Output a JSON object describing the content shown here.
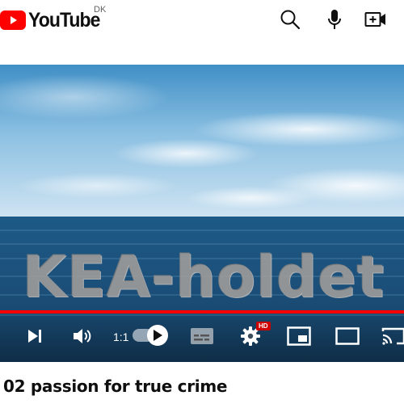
{
  "header": {
    "brand": "YouTube",
    "country_code": "DK",
    "icons": {
      "search": "search-icon",
      "voice": "microphone-icon",
      "create": "create-video-icon"
    }
  },
  "player": {
    "overlay_text": "KEA-holdet",
    "progress_fraction": 1.0,
    "speed_label": "1:1",
    "hd_badge": "HD",
    "controls": {
      "next": "skip-next-icon",
      "volume": "volume-icon",
      "autoplay": "autoplay-toggle",
      "captions": "captions-icon",
      "settings": "settings-gear-icon",
      "miniplayer": "miniplayer-icon",
      "theater": "theater-mode-icon",
      "cast": "cast-icon"
    }
  },
  "video": {
    "title": "02 passion for true crime"
  },
  "colors": {
    "brand_red": "#ff0000",
    "progress_red": "#ff0000",
    "hd_badge_red": "#cc0000",
    "text_primary": "#0f0f0f"
  }
}
